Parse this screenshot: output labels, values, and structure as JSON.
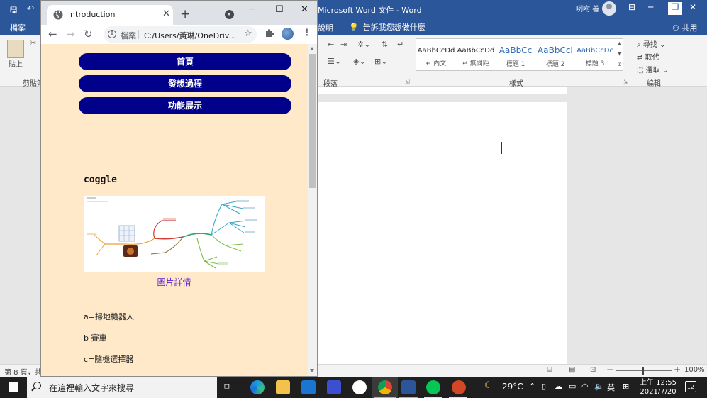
{
  "word": {
    "title": "Microsoft Word 文件 - Word",
    "user": "咧咐 善",
    "tab_file": "檔案",
    "tab_view": "說明",
    "tell_me": "告訴我您想做什麼",
    "share": "共用",
    "paste": "貼上",
    "clipboard_group": "剪貼簿",
    "paragraph_group": "段落",
    "styles_group": "樣式",
    "editing_group": "編輯",
    "styles": [
      {
        "preview": "AaBbCcDd",
        "name": "↵ 內文"
      },
      {
        "preview": "AaBbCcDd",
        "name": "↵ 無間距"
      },
      {
        "preview": "AaBbCc",
        "name": "標題 1"
      },
      {
        "preview": "AaBbCcI",
        "name": "標題 2"
      },
      {
        "preview": "AaBbCcDc",
        "name": "標題 3"
      }
    ],
    "find": "尋找",
    "replace": "取代",
    "select": "選取",
    "status_pages": "第 8 頁，共",
    "zoom": "100%"
  },
  "browser": {
    "tab_title": "introduction",
    "file_label": "檔案",
    "url": "C:/Users/黃琳/OneDriv...",
    "nav_buttons": [
      "首頁",
      "發想過程",
      "功能展示"
    ],
    "heading": "coggle",
    "image_caption": "圖片詳情",
    "legend": [
      "a=掃地機器人",
      "b  賽車",
      "c=隨機選擇器"
    ]
  },
  "taskbar": {
    "search_placeholder": "在這裡輸入文字來搜尋",
    "temperature": "29°C",
    "ime": "英",
    "time": "上午 12:55",
    "date": "2021/7/20",
    "notification_count": "12"
  },
  "colors": {
    "word_blue": "#2b579a",
    "page_bg": "#ffe9c9",
    "nav_button": "#00008b",
    "caption_link": "#5a1fd1"
  }
}
